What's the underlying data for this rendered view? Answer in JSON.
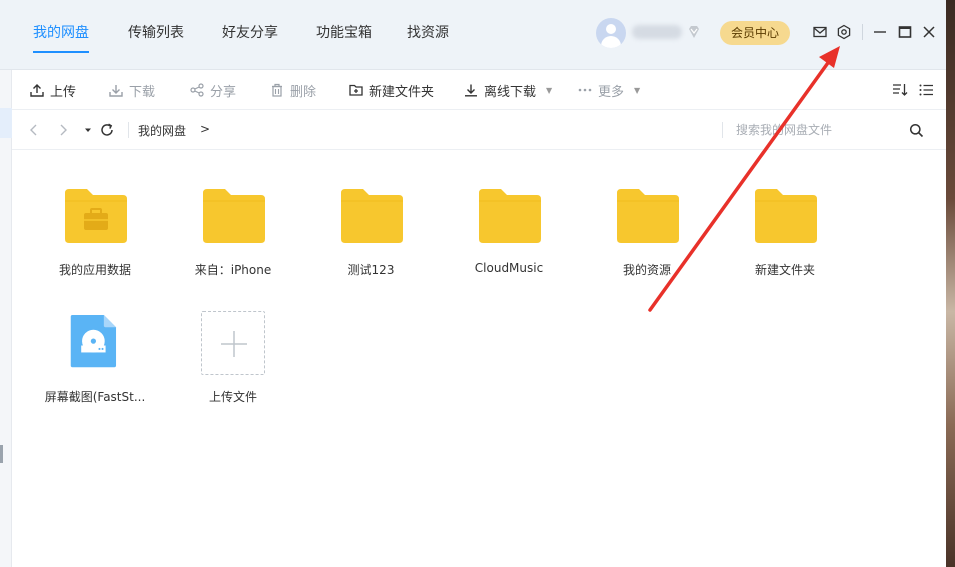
{
  "tabs": [
    {
      "label": "我的网盘",
      "active": true
    },
    {
      "label": "传输列表",
      "active": false
    },
    {
      "label": "好友分享",
      "active": false
    },
    {
      "label": "功能宝箱",
      "active": false
    },
    {
      "label": "找资源",
      "active": false
    }
  ],
  "account": {
    "member_center_label": "会员中心"
  },
  "toolbar": {
    "upload": "上传",
    "download": "下载",
    "share": "分享",
    "delete": "删除",
    "new_folder": "新建文件夹",
    "offline_download": "离线下载",
    "more": "更多"
  },
  "nav": {
    "breadcrumb": "我的网盘",
    "breadcrumb_sep": ">",
    "search_placeholder": "搜索我的网盘文件"
  },
  "files": [
    {
      "name": "我的应用数据",
      "type": "app-folder"
    },
    {
      "name": "来自：iPhone",
      "type": "folder"
    },
    {
      "name": "测试123",
      "type": "folder"
    },
    {
      "name": "CloudMusic",
      "type": "folder"
    },
    {
      "name": "我的资源",
      "type": "folder"
    },
    {
      "name": "新建文件夹",
      "type": "folder"
    },
    {
      "name": "屏幕截图(FastSt...",
      "type": "disc-image"
    }
  ],
  "upload_tile": {
    "label": "上传文件"
  },
  "colors": {
    "accent": "#1e8fff",
    "folder": "#f7c72e",
    "annotation_arrow": "#e8312a",
    "member_button": "#f6d98f"
  }
}
